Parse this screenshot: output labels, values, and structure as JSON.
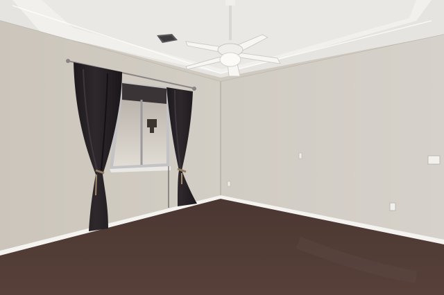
{
  "scene": {
    "subject": "empty-room",
    "features": [
      "tray-ceiling",
      "ceiling-fan",
      "hvac-vent",
      "window",
      "dark-curtains",
      "carpet-floor",
      "baseboards",
      "wall-outlets",
      "thermostat-plate"
    ]
  },
  "colors": {
    "ceiling": "#e9e7e3",
    "ceiling_tray": "#f2f1ee",
    "left_wall": "#cdc7bd",
    "back_wall": "#d3cec6",
    "baseboard": "#f4f3f0",
    "carpet": "#4e3a34",
    "curtain": "#262126",
    "window_frame": "#c2c2c4",
    "window_glass": "#d8d3cc"
  }
}
